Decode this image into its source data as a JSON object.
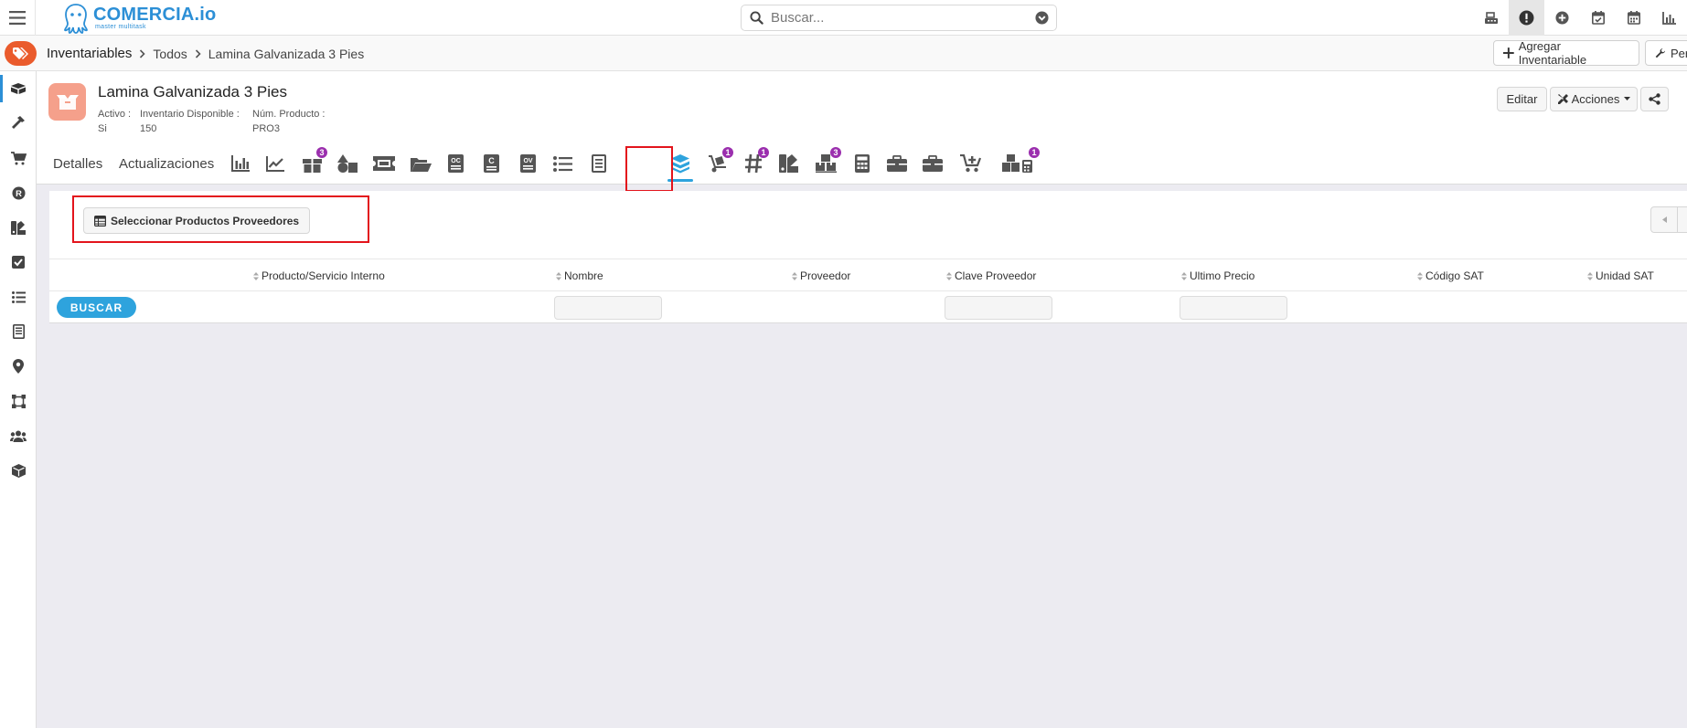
{
  "app": {
    "logo_name": "COMERCIA.io",
    "logo_tagline": "master multitask"
  },
  "search": {
    "placeholder": "Buscar..."
  },
  "breadcrumb": [
    "Inventariables",
    "Todos",
    "Lamina Galvanizada 3 Pies"
  ],
  "crumb_actions": {
    "add_label": "Agregar Inventariable",
    "permissions_label": "Per"
  },
  "product": {
    "title": "Lamina Galvanizada 3 Pies",
    "meta": [
      {
        "label": "Activo :",
        "value": "Si"
      },
      {
        "label": "Inventario Disponible :",
        "value": "150"
      },
      {
        "label": "Núm. Producto :",
        "value": "PRO3"
      }
    ],
    "edit_label": "Editar",
    "actions_label": "Acciones"
  },
  "tabs": {
    "text": [
      "Detalles",
      "Actualizaciones"
    ],
    "badges": {
      "boxes": "3",
      "supplier_products": "1",
      "serials": "1",
      "lots": "3",
      "kits": "1"
    }
  },
  "content": {
    "select_button_label": "Seleccionar Productos Proveedores",
    "columns": [
      "Producto/Servicio Interno",
      "Nombre",
      "Proveedor",
      "Clave Proveedor",
      "Ultimo Precio",
      "Código SAT",
      "Unidad SAT"
    ],
    "search_button_label": "BUSCAR"
  },
  "colors": {
    "brand": "#2c8fd6",
    "accent_tab": "#2ea3dd",
    "badge": "#9b2fae",
    "highlight": "#e3141c",
    "crumb_logo": "#ea5b2c"
  }
}
